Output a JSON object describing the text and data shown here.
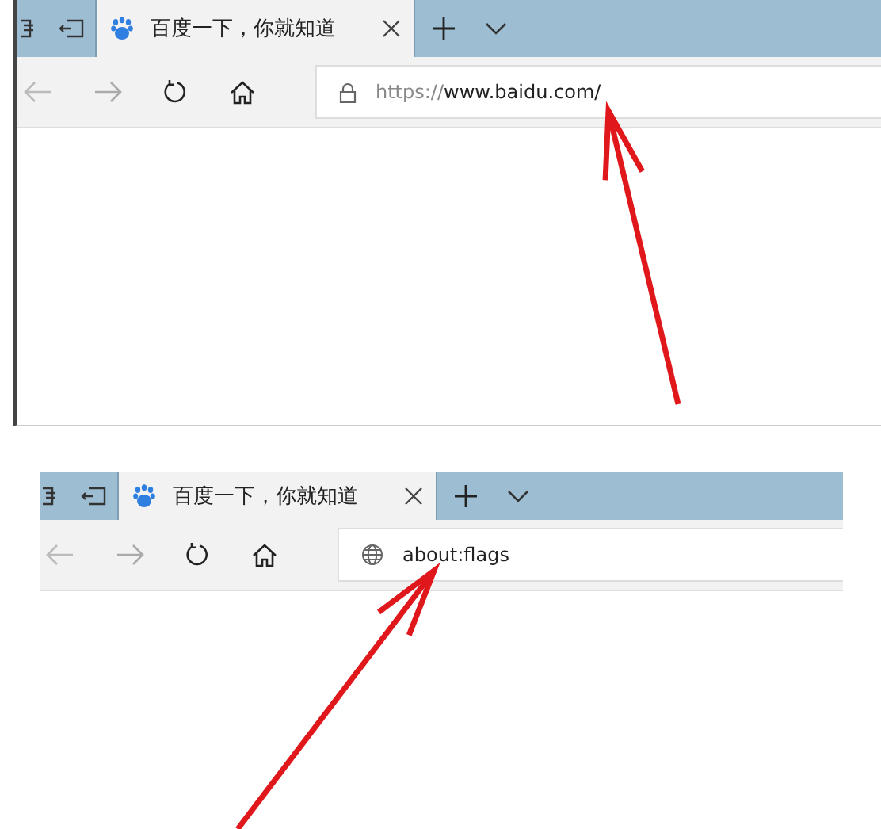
{
  "snapshots": [
    {
      "tab": {
        "title": "百度一下，你就知道",
        "selected": true
      },
      "address": {
        "kind": "secure",
        "scheme": "https://",
        "rest": "www.baidu.com/"
      }
    },
    {
      "tab": {
        "title": "百度一下，你就知道",
        "selected": true
      },
      "address": {
        "kind": "page",
        "rest": "about:flags"
      }
    }
  ]
}
